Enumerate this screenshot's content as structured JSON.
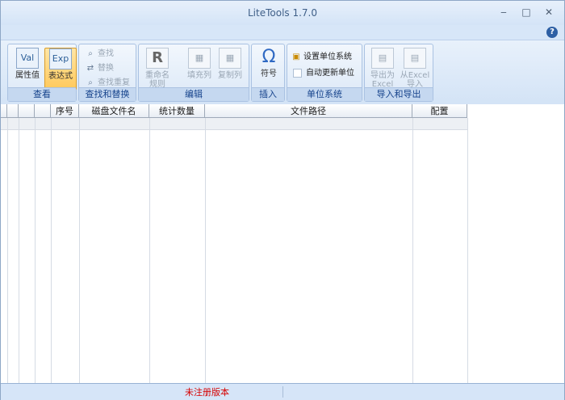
{
  "window": {
    "title": "LiteTools 1.7.0",
    "min_label": "‒",
    "max_label": "□",
    "close_label": "✕",
    "help_label": "?"
  },
  "ribbon": {
    "view": {
      "label": "查看",
      "property_button": "属性值",
      "property_icon": "Val",
      "expression_button": "表达式",
      "expression_icon": "Exp"
    },
    "find": {
      "label": "查找和替换",
      "find": "查找",
      "replace": "替换",
      "find_duplicates": "查找重复"
    },
    "edit": {
      "label": "编辑",
      "rename_line1": "重命名",
      "rename_line2": "规则",
      "rename_icon": "R",
      "fill": "填充列",
      "copy": "复制列"
    },
    "insert": {
      "label": "插入",
      "symbol": "符号",
      "symbol_icon": "Ω"
    },
    "units": {
      "label": "单位系统",
      "set_units": "设置单位系统",
      "auto_update": "自动更新单位"
    },
    "io": {
      "label": "导入和导出",
      "export_line1": "导出为",
      "export_line2": "Excel",
      "import_line1": "从Excel",
      "import_line2": "导入"
    }
  },
  "table": {
    "columns": [
      "序号",
      "磁盘文件名",
      "统计数量",
      "文件路径",
      "配置"
    ]
  },
  "status": {
    "text": "未注册版本"
  }
}
